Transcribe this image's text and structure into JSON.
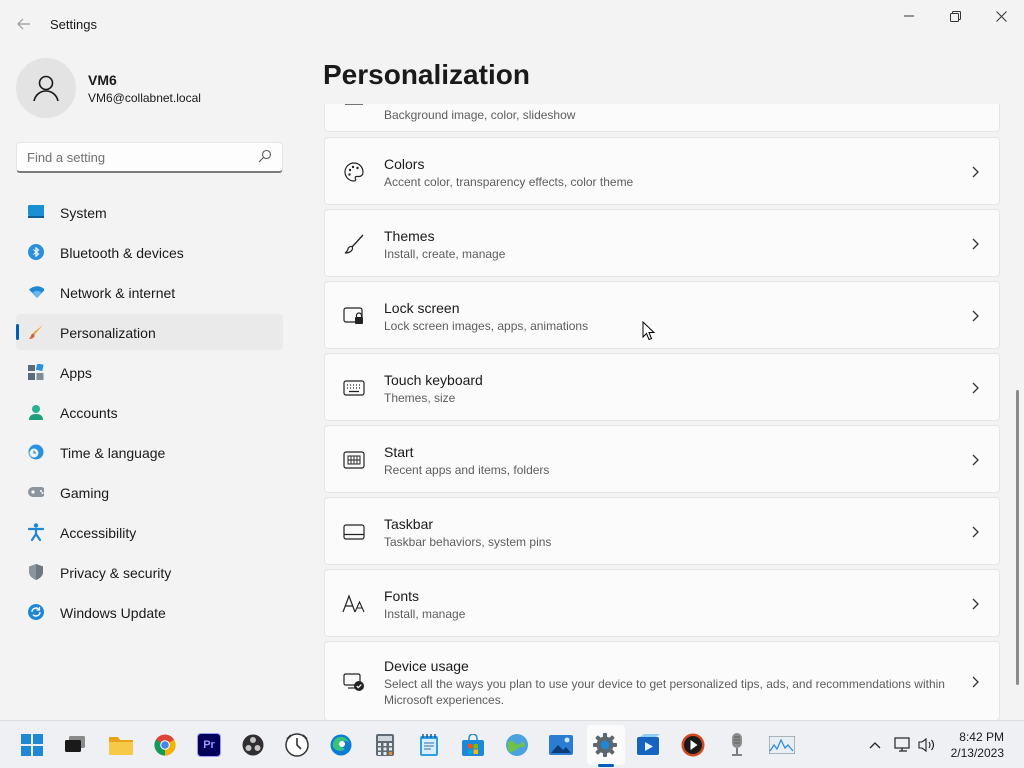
{
  "window": {
    "title": "Settings"
  },
  "profile": {
    "name": "VM6",
    "email": "VM6@collabnet.local"
  },
  "search": {
    "placeholder": "Find a setting"
  },
  "sidebar": {
    "items": [
      {
        "label": "System",
        "icon": "system-icon"
      },
      {
        "label": "Bluetooth & devices",
        "icon": "bluetooth-icon"
      },
      {
        "label": "Network & internet",
        "icon": "wifi-icon"
      },
      {
        "label": "Personalization",
        "icon": "brush-icon",
        "active": true
      },
      {
        "label": "Apps",
        "icon": "apps-icon"
      },
      {
        "label": "Accounts",
        "icon": "accounts-icon"
      },
      {
        "label": "Time & language",
        "icon": "time-language-icon"
      },
      {
        "label": "Gaming",
        "icon": "gaming-icon"
      },
      {
        "label": "Accessibility",
        "icon": "accessibility-icon"
      },
      {
        "label": "Privacy & security",
        "icon": "shield-icon"
      },
      {
        "label": "Windows Update",
        "icon": "update-icon"
      }
    ]
  },
  "main": {
    "title": "Personalization",
    "cards": [
      {
        "title": "",
        "subtitle": "Background image, color, slideshow",
        "icon": "background-icon"
      },
      {
        "title": "Colors",
        "subtitle": "Accent color, transparency effects, color theme",
        "icon": "palette-icon"
      },
      {
        "title": "Themes",
        "subtitle": "Install, create, manage",
        "icon": "brush-icon"
      },
      {
        "title": "Lock screen",
        "subtitle": "Lock screen images, apps, animations",
        "icon": "lock-screen-icon"
      },
      {
        "title": "Touch keyboard",
        "subtitle": "Themes, size",
        "icon": "keyboard-icon"
      },
      {
        "title": "Start",
        "subtitle": "Recent apps and items, folders",
        "icon": "start-icon"
      },
      {
        "title": "Taskbar",
        "subtitle": "Taskbar behaviors, system pins",
        "icon": "taskbar-icon"
      },
      {
        "title": "Fonts",
        "subtitle": "Install, manage",
        "icon": "fonts-icon"
      },
      {
        "title": "Device usage",
        "subtitle": "Select all the ways you plan to use your device to get personalized tips, ads, and recommendations within Microsoft experiences.",
        "icon": "device-usage-icon"
      }
    ]
  },
  "taskbar": {
    "apps": [
      "windows-start-icon",
      "task-view-icon",
      "file-explorer-icon",
      "chrome-icon",
      "premiere-icon",
      "obs-icon",
      "clock-app-icon",
      "edge-icon",
      "calculator-icon",
      "notepad-icon",
      "store-icon",
      "maps-icon",
      "photos-icon",
      "settings-icon",
      "video-editor-icon",
      "media-player-icon",
      "microphone-icon",
      "performance-monitor-icon"
    ],
    "premiere_label": "Pr",
    "clock": {
      "time": "8:42 PM",
      "date": "2/13/2023"
    }
  },
  "colors": {
    "accent": "#005fb8"
  }
}
